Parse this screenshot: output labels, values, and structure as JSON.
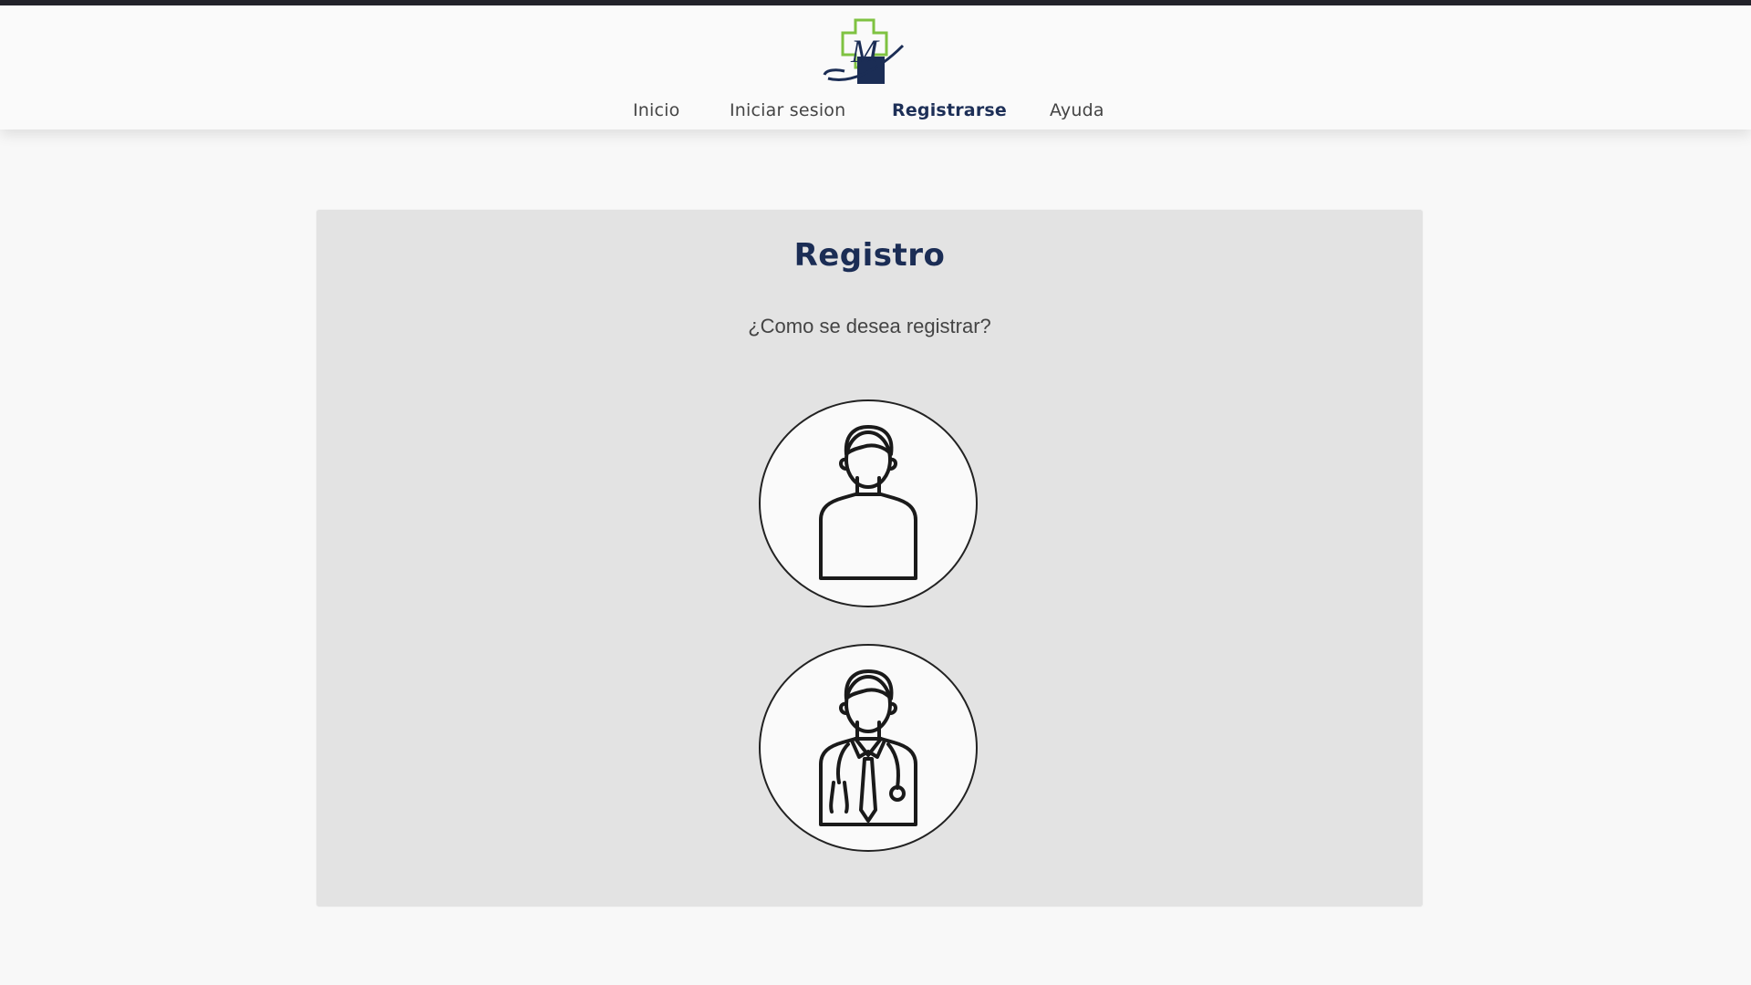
{
  "header": {
    "logo_letter": "M",
    "nav": [
      {
        "label": "Inicio",
        "active": false
      },
      {
        "label": "Iniciar sesion",
        "active": false
      },
      {
        "label": "Registrarse",
        "active": true
      },
      {
        "label": "Ayuda",
        "active": false
      }
    ]
  },
  "registro": {
    "title": "Registro",
    "question": "¿Como se desea registrar?",
    "options": [
      {
        "icon": "patient-icon"
      },
      {
        "icon": "doctor-icon"
      }
    ]
  },
  "colors": {
    "brand_navy": "#1b2d55",
    "brand_green": "#7fc241",
    "card_bg": "#e3e3e3",
    "page_bg": "#f8f8f8"
  }
}
